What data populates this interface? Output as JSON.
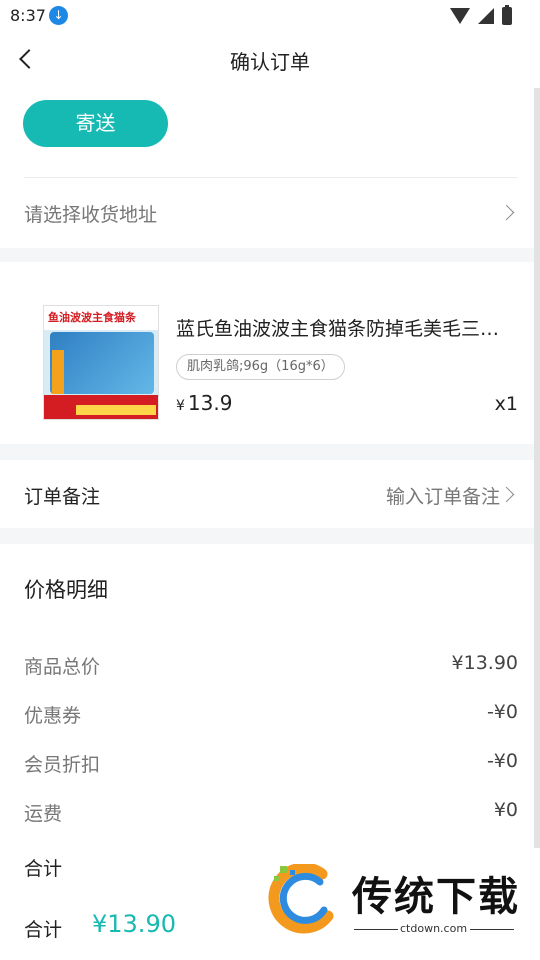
{
  "status_bar": {
    "time": "8:37",
    "download_icon": "download-icon",
    "icons": [
      "wifi-icon",
      "signal-icon",
      "battery-icon"
    ]
  },
  "nav": {
    "title": "确认订单",
    "back_icon": "back-arrow-icon"
  },
  "delivery": {
    "send_button": "寄送",
    "address_placeholder": "请选择收货地址"
  },
  "product": {
    "image_label": "鱼油波波主食猫条",
    "title": "蓝氏鱼油波波主食猫条防掉毛美毛三…",
    "spec": "肌肉乳鸽;96g（16g*6）",
    "currency": "¥",
    "price": "13.9",
    "quantity": "x1"
  },
  "remark": {
    "label": "订单备注",
    "placeholder": "输入订单备注"
  },
  "price_detail": {
    "heading": "价格明细",
    "rows": [
      {
        "label": "商品总价",
        "value": "¥13.90"
      },
      {
        "label": "优惠券",
        "value": "-¥0"
      },
      {
        "label": "会员折扣",
        "value": "-¥0"
      },
      {
        "label": "运费",
        "value": "¥0"
      }
    ],
    "total_label": "合计"
  },
  "bottom_bar": {
    "total_label": "合计",
    "total_value": "¥13.90"
  },
  "watermark": {
    "brand": "传统下载",
    "domain": "ctdown.com"
  },
  "colors": {
    "accent": "#17b9b3",
    "background": "#f5f6f8"
  }
}
